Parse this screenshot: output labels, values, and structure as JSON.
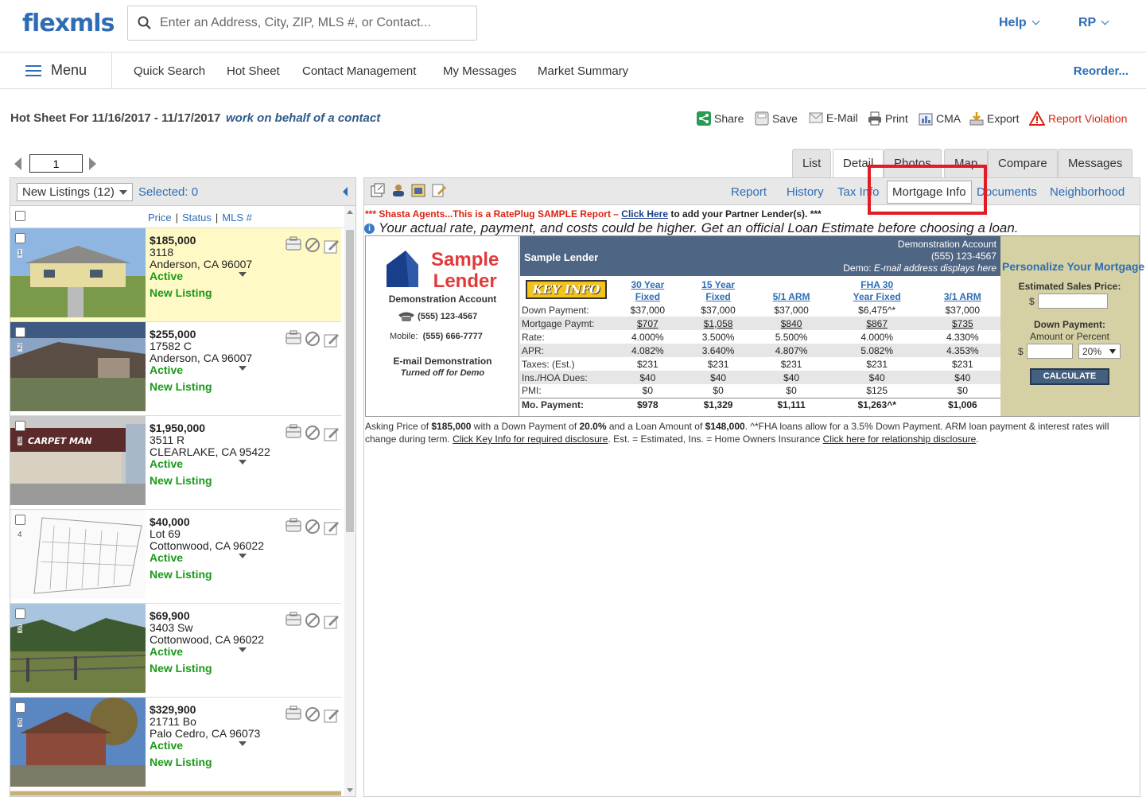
{
  "app": {
    "logo": "flexmls"
  },
  "search": {
    "placeholder": "Enter an Address, City, ZIP, MLS #, or Contact..."
  },
  "top_right": {
    "help": "Help",
    "user": "RP"
  },
  "nav": {
    "menu": "Menu",
    "items": [
      "Quick Search",
      "Hot Sheet",
      "Contact Management",
      "My Messages",
      "Market Summary"
    ],
    "reorder": "Reorder..."
  },
  "page": {
    "title": "Hot Sheet For 11/16/2017 - 11/17/2017",
    "behalf": "work on behalf of a contact"
  },
  "actions": [
    "Share",
    "Save",
    "E-Mail",
    "Print",
    "CMA",
    "Export",
    "Report Violation"
  ],
  "pager": {
    "page": "1"
  },
  "tabs": [
    "List",
    "Detail",
    "Photos",
    "Map",
    "Compare",
    "Messages"
  ],
  "left_panel": {
    "filter": "New Listings (12)",
    "selected": "Selected: 0",
    "sort": [
      "Price",
      "Status",
      "MLS #"
    ]
  },
  "listings": [
    {
      "num": "1",
      "price": "$185,000",
      "addr": "3118",
      "city": "Anderson, CA 96007",
      "status": "Active",
      "tag": "New Listing"
    },
    {
      "num": "2",
      "price": "$255,000",
      "addr": "17582 C",
      "city": "Anderson, CA 96007",
      "status": "Active",
      "tag": "New Listing"
    },
    {
      "num": "3",
      "price": "$1,950,000",
      "addr": "3511 R",
      "city": "CLEARLAKE, CA 95422",
      "status": "Active",
      "tag": "New Listing"
    },
    {
      "num": "4",
      "price": "$40,000",
      "addr": "Lot 69",
      "city": "Cottonwood, CA 96022",
      "status": "Active",
      "tag": "New Listing"
    },
    {
      "num": "5",
      "price": "$69,900",
      "addr": "3403 Sw",
      "city": "Cottonwood, CA 96022",
      "status": "Active",
      "tag": "New Listing"
    },
    {
      "num": "6",
      "price": "$329,900",
      "addr": "21711 Bo",
      "city": "Palo Cedro, CA 96073",
      "status": "Active",
      "tag": "New Listing"
    }
  ],
  "detail_links": [
    "Report",
    "History",
    "Tax Info",
    "Mortgage Info",
    "Documents",
    "Neighborhood"
  ],
  "rateplug": {
    "notice_pre": "*** Shasta Agents...This is a RatePlug SAMPLE Report – ",
    "notice_link": "Click Here",
    "notice_post": " to add your Partner Lender(s). ***",
    "note": "Your actual rate, payment, and costs could be higher. Get an official Loan Estimate before choosing a loan."
  },
  "lender": {
    "name_line1": "Sample",
    "name_line2": "Lender",
    "account": "Demonstration Account",
    "phone": "(555) 123-4567",
    "mobile_label": "Mobile:",
    "mobile": "(555) 666-7777",
    "email_title": "E-mail Demonstration",
    "email_note": "Turned off for Demo"
  },
  "rate_table": {
    "lender_label": "Sample Lender",
    "demo_account": "Demonstration Account",
    "demo_phone": "(555) 123-4567",
    "demo_email_prefix": "Demo: ",
    "demo_email": "E-mail address displays here",
    "key_info": "KEY INFO",
    "columns": [
      [
        "30 Year",
        "Fixed"
      ],
      [
        "15 Year",
        "Fixed"
      ],
      [
        "",
        "5/1 ARM"
      ],
      [
        "FHA 30",
        "Year Fixed"
      ],
      [
        "",
        "3/1 ARM"
      ]
    ],
    "rows": [
      {
        "label": "Down Payment:",
        "values": [
          "$37,000",
          "$37,000",
          "$37,000",
          "$6,475^*",
          "$37,000"
        ]
      },
      {
        "label": "Mortgage Paymt:",
        "values": [
          "$707",
          "$1,058",
          "$840",
          "$867",
          "$735"
        ],
        "link": true
      },
      {
        "label": "Rate:",
        "values": [
          "4.000%",
          "3.500%",
          "5.500%",
          "4.000%",
          "4.330%"
        ]
      },
      {
        "label": "APR:",
        "values": [
          "4.082%",
          "3.640%",
          "4.807%",
          "5.082%",
          "4.353%"
        ]
      },
      {
        "label": "Taxes: (Est.)",
        "values": [
          "$231",
          "$231",
          "$231",
          "$231",
          "$231"
        ]
      },
      {
        "label": "Ins./HOA Dues:",
        "values": [
          "$40",
          "$40",
          "$40",
          "$40",
          "$40"
        ]
      },
      {
        "label": "PMI:",
        "values": [
          "$0",
          "$0",
          "$0",
          "$125",
          "$0"
        ]
      },
      {
        "label": "Mo. Payment:",
        "values": [
          "$978",
          "$1,329",
          "$1,111",
          "$1,263^*",
          "$1,006"
        ]
      }
    ]
  },
  "personalize": {
    "title": "Personalize Your Mortgage",
    "est_price_label": "Estimated Sales Price:",
    "dollar": "$",
    "down_label": "Down Payment:",
    "amount_or_percent": "Amount or Percent",
    "percent_value": "20%",
    "calculate": "CALCULATE"
  },
  "disclaimer": {
    "t1": "Asking Price of ",
    "price": "$185,000",
    "t2": " with a Down Payment of ",
    "dp": "20.0%",
    "t3": " and a Loan Amount of ",
    "loan": "$148,000",
    "t4": ". ^*FHA loans allow for a 3.5% Down Payment. ARM loan payment & interest rates will change during term. ",
    "link1": "Click Key Info for required disclosure",
    "t5": ". Est. = Estimated, Ins. = Home Owners Insurance ",
    "link2": "Click here for relationship disclosure",
    "t6": "."
  },
  "colors": {
    "brand": "#2e6db5",
    "active_green": "#1a9a1a",
    "highlight": "#fff9c6",
    "annotation_red": "#e21c24"
  }
}
